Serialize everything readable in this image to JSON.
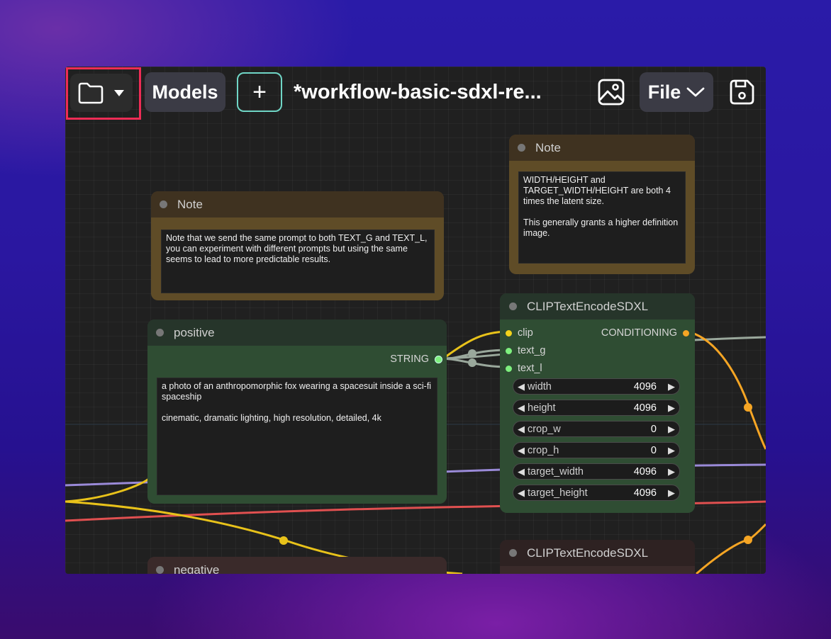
{
  "toolbar": {
    "models_label": "Models",
    "add_label": "+",
    "workflow_title": "*workflow-basic-sdxl-re...",
    "file_label": "File"
  },
  "notes": [
    {
      "title": "Note",
      "text": "Note that we send the same prompt to both TEXT_G and TEXT_L, you can experiment with different prompts but using the same seems to lead to more predictable results."
    },
    {
      "title": "Note",
      "text": "WIDTH/HEIGHT and TARGET_WIDTH/HEIGHT are both 4 times the latent size.\n\nThis generally grants a higher definition image."
    }
  ],
  "positive_node": {
    "title": "positive",
    "output_label": "STRING",
    "text": "a photo of an anthropomorphic fox wearing a spacesuit inside a sci-fi spaceship\n\ncinematic, dramatic lighting, high resolution, detailed, 4k"
  },
  "negative_node": {
    "title": "negative"
  },
  "clip_node": {
    "title": "CLIPTextEncodeSDXL",
    "inputs": [
      "clip",
      "text_g",
      "text_l"
    ],
    "output_label": "CONDITIONING",
    "widgets": [
      {
        "label": "width",
        "value": "4096"
      },
      {
        "label": "height",
        "value": "4096"
      },
      {
        "label": "crop_w",
        "value": "0"
      },
      {
        "label": "crop_h",
        "value": "0"
      },
      {
        "label": "target_width",
        "value": "4096"
      },
      {
        "label": "target_height",
        "value": "4096"
      }
    ]
  },
  "clip_node_2": {
    "title": "CLIPTextEncodeSDXL"
  },
  "colors": {
    "highlight": "#ee2c55",
    "clip_link": "#e8c21a",
    "conditioning_link": "#f5a524",
    "string_link": "#9aa89c",
    "model_link": "#9a8ad8",
    "red_link": "#e05050"
  }
}
